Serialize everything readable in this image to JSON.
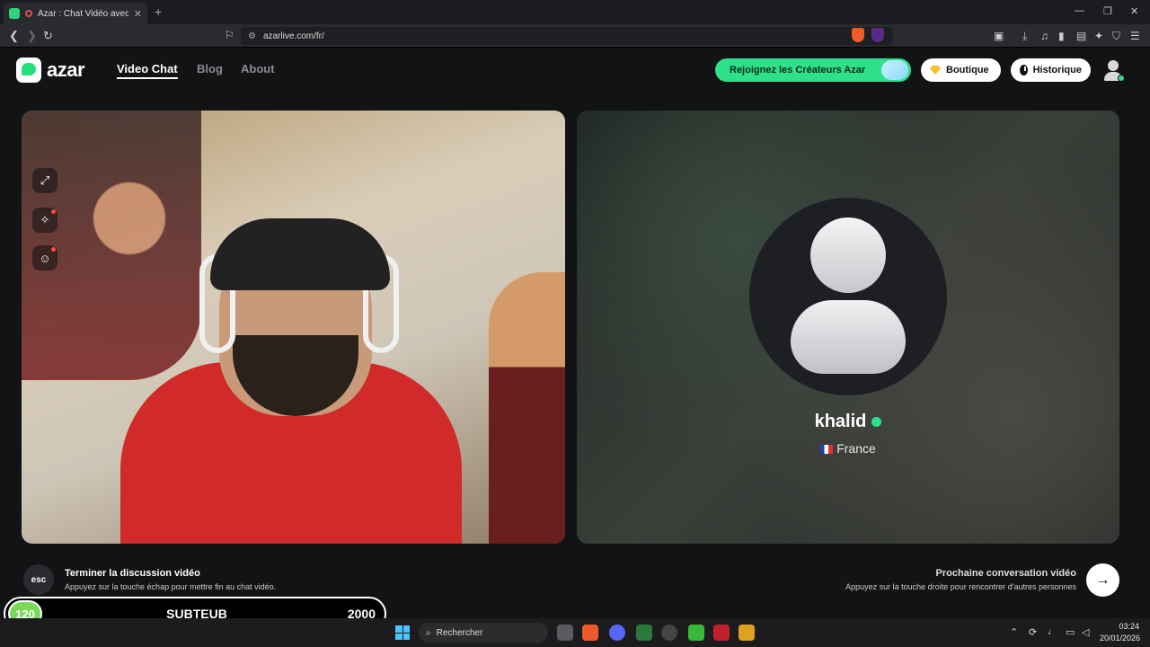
{
  "browser": {
    "tab_title": "Azar : Chat Vidéo avec de no",
    "tab_close": "✕",
    "new_tab": "+",
    "url": "azarlive.com/fr/",
    "window_controls": [
      "—",
      "❐",
      "✕"
    ]
  },
  "header": {
    "logo_text": "azar",
    "nav": [
      {
        "label": "Video Chat",
        "active": true
      },
      {
        "label": "Blog",
        "active": false
      },
      {
        "label": "About",
        "active": false
      }
    ],
    "creators_label": "Rejoignez les Créateurs Azar",
    "shop_label": "Boutique",
    "history_label": "Historique"
  },
  "local_video": {
    "tools": [
      "expand-icon",
      "magic-wand-icon",
      "face-filter-icon"
    ]
  },
  "peer": {
    "name": "khalid",
    "country": "France",
    "country_flag": "FR"
  },
  "actions": {
    "esc_label": "esc",
    "end_title": "Terminer la discussion vidéo",
    "end_sub": "Appuyez sur la touche échap pour mettre fin au chat vidéo.",
    "next_title": "Prochaine conversation vidéo",
    "next_sub": "Appuyez sur la touche droite pour rencontrer d'autres personnes",
    "next_arrow": "→"
  },
  "overlay": {
    "count": "120",
    "label": "SUBTEUB",
    "goal": "2000"
  },
  "taskbar": {
    "search_placeholder": "Rechercher",
    "time": "03:24",
    "date": "20/01/2026"
  },
  "colors": {
    "accent_green": "#2ee08a",
    "page_bg": "#121315"
  }
}
